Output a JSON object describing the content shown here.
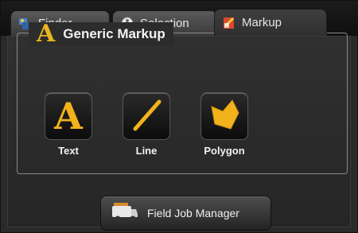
{
  "tabs": [
    {
      "label": "Finder",
      "icon": "finder-icon"
    },
    {
      "label": "Selection",
      "icon": "selection-icon"
    },
    {
      "label": "Markup",
      "icon": "markup-icon"
    }
  ],
  "group": {
    "title": "Generic Markup",
    "icon_letter": "A"
  },
  "tools": [
    {
      "label": "Text",
      "icon": "text-tool-icon"
    },
    {
      "label": "Line",
      "icon": "line-tool-icon"
    },
    {
      "label": "Polygon",
      "icon": "polygon-tool-icon"
    }
  ],
  "field_job_button": {
    "label": "Field Job Manager",
    "icon": "truck-icon"
  },
  "colors": {
    "accent_gold": "#e8b51e",
    "background": "#2a2a2a"
  }
}
